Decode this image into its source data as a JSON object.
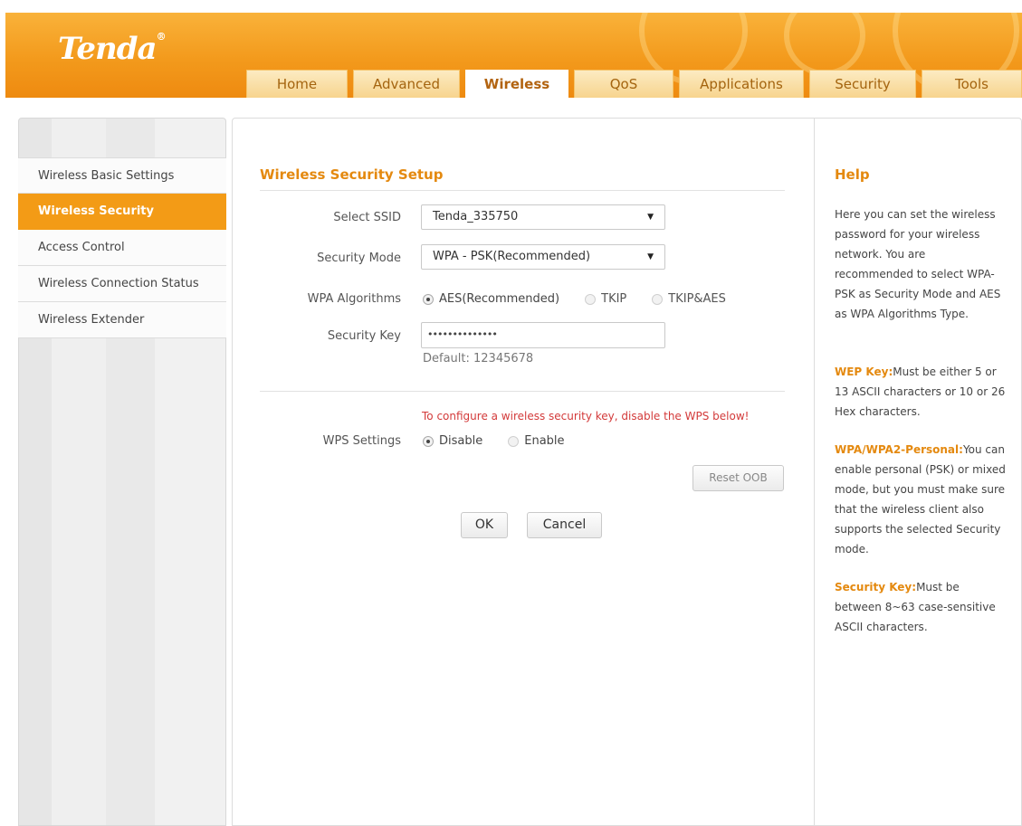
{
  "brand": {
    "logo": "Tenda",
    "reg": "®"
  },
  "nav": {
    "tabs": [
      {
        "label": "Home"
      },
      {
        "label": "Advanced"
      },
      {
        "label": "Wireless"
      },
      {
        "label": "QoS"
      },
      {
        "label": "Applications"
      },
      {
        "label": "Security"
      },
      {
        "label": "Tools"
      }
    ],
    "active": "Wireless"
  },
  "sidebar": {
    "items": [
      {
        "label": "Wireless Basic Settings"
      },
      {
        "label": "Wireless Security"
      },
      {
        "label": "Access Control"
      },
      {
        "label": "Wireless Connection Status"
      },
      {
        "label": "Wireless Extender"
      }
    ],
    "active": "Wireless Security"
  },
  "main": {
    "title": "Wireless Security Setup",
    "ssid": {
      "label": "Select SSID",
      "value": "Tenda_335750"
    },
    "mode": {
      "label": "Security Mode",
      "value": "WPA - PSK(Recommended)"
    },
    "algorithms": {
      "label": "WPA Algorithms",
      "options": [
        "AES(Recommended)",
        "TKIP",
        "TKIP&AES"
      ],
      "selected": "AES(Recommended)"
    },
    "key": {
      "label": "Security Key",
      "value": "••••••••••••••",
      "hint": "Default: 12345678"
    },
    "wps": {
      "warning": "To configure a wireless security key, disable the WPS below!",
      "label": "WPS Settings",
      "options": [
        "Disable",
        "Enable"
      ],
      "selected": "Disable",
      "reset_label": "Reset OOB"
    },
    "ok_label": "OK",
    "cancel_label": "Cancel"
  },
  "help": {
    "title": "Help",
    "intro": "Here you can set the wireless password for your wireless network. You are recommended to select WPA-PSK as Security Mode and AES as WPA Algorithms Type.",
    "wep_key": "WEP Key:",
    "wep_text": "Must be either 5 or 13 ASCII characters or 10 or 26 Hex characters.",
    "wpa_key": "WPA/WPA2-Personal:",
    "wpa_text": "You can enable personal (PSK) or mixed mode, but you must make sure that the wireless client also supports the selected Security mode.",
    "sec_key": "Security Key:",
    "sec_text": "Must be between 8~63 case-sensitive ASCII characters."
  },
  "colors": {
    "accent": "#f39b16",
    "title": "#e4890f",
    "warning": "#d33a3a"
  }
}
